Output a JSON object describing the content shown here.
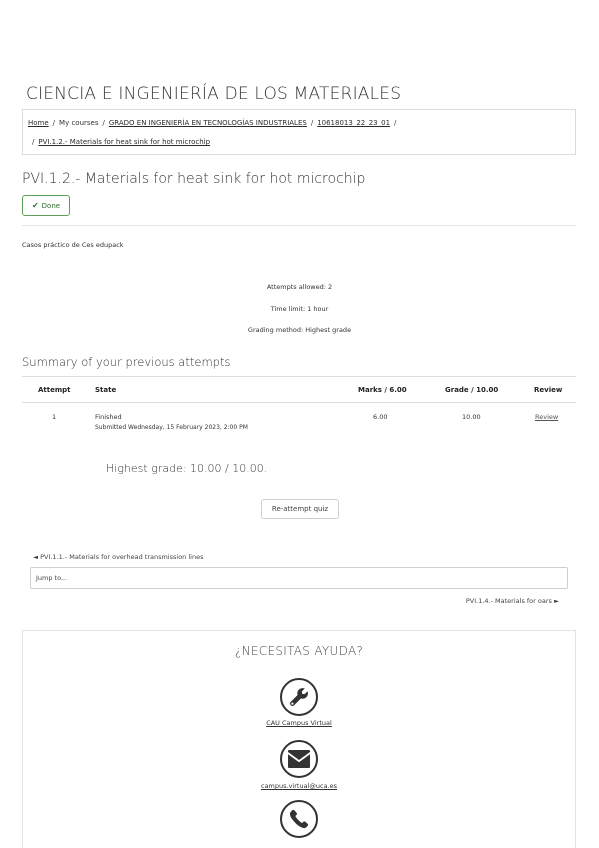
{
  "course": {
    "title": "CIENCIA E INGENIERÍA DE LOS MATERIALES"
  },
  "breadcrumb": {
    "home": "Home",
    "my_courses": "My courses",
    "degree": "GRADO EN INGENIERÍA EN TECNOLOGÍAS INDUSTRIALES",
    "course_code": "10618013_22_23_01",
    "activity": "PVI.1.2.- Materials for heat sink for hot microchip",
    "separator": "/"
  },
  "activity": {
    "title": "PVI.1.2.- Materials for heat sink for hot microchip",
    "done_label": "Done",
    "intro": "Casos práctico de Ces edupack"
  },
  "quiz_info": {
    "attempts_allowed": "Attempts allowed: 2",
    "time_limit": "Time limit: 1 hour",
    "grading_method": "Grading method: Highest grade"
  },
  "summary": {
    "heading": "Summary of your previous attempts",
    "columns": [
      "Attempt",
      "State",
      "Marks / 6.00",
      "Grade / 10.00",
      "Review"
    ],
    "rows": [
      {
        "attempt": "1",
        "state": "Finished",
        "submitted": "Submitted Wednesday, 15 February 2023, 2:00 PM",
        "marks": "6.00",
        "grade": "10.00",
        "review": "Review"
      }
    ]
  },
  "highest_grade": "Highest grade: 10.00 / 10.00.",
  "reattempt_label": "Re-attempt quiz",
  "navigation": {
    "prev": "◄ PVI.1.1.- Materials for overhead transmission lines",
    "jump_placeholder": "Jump to...",
    "next": "PVI.1.4.- Materials for oars ►"
  },
  "help": {
    "title": "¿NECESITAS AYUDA?",
    "items": [
      {
        "label": "CAU Campus Virtual",
        "icon": "wrench-icon"
      },
      {
        "label": "campus.virtual@uca.es",
        "icon": "envelope-icon"
      },
      {
        "label": "",
        "icon": "phone-icon"
      }
    ]
  }
}
